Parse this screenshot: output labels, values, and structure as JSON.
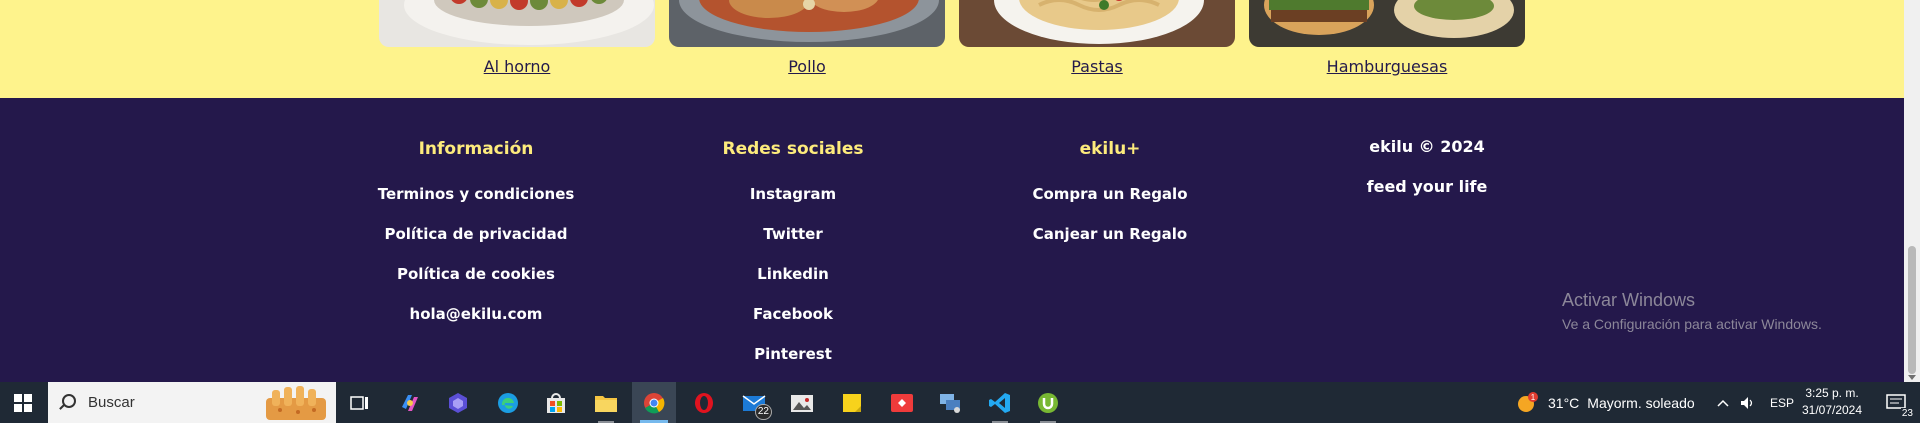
{
  "categories": [
    {
      "label": "Al horno",
      "icon": "baked-vegetables-photo"
    },
    {
      "label": "Pollo",
      "icon": "chicken-dish-photo"
    },
    {
      "label": "Pastas",
      "icon": "pasta-dish-photo"
    },
    {
      "label": "Hamburguesas",
      "icon": "burger-photo"
    }
  ],
  "footer": {
    "info": {
      "heading": "Información",
      "links": [
        "Terminos y condiciones",
        "Política de privacidad",
        "Política de cookies",
        "hola@ekilu.com"
      ]
    },
    "social": {
      "heading": "Redes sociales",
      "links": [
        "Instagram",
        "Twitter",
        "Linkedin",
        "Facebook",
        "Pinterest"
      ]
    },
    "plus": {
      "heading": "ekilu+",
      "links": [
        "Compra un Regalo",
        "Canjear un Regalo"
      ]
    },
    "brand": {
      "copyright": "ekilu © 2024",
      "tagline": "feed your life"
    }
  },
  "watermark": {
    "title": "Activar Windows",
    "subtitle": "Ve a Configuración para activar Windows."
  },
  "colors": {
    "band": "#fef38c",
    "footer_bg": "#24184b",
    "heading": "#fdeb7c",
    "link": "#ffffff"
  },
  "taskbar": {
    "search_placeholder": "Buscar",
    "apps": [
      "windows-start-icon",
      "task-view-icon",
      "copilot-icon",
      "app-icon",
      "edge-icon",
      "store-icon",
      "file-explorer-icon",
      "chrome-icon",
      "opera-icon",
      "mail-icon",
      "photos-icon",
      "sticky-notes-icon",
      "anydesk-icon",
      "network-app-icon",
      "vscode-icon",
      "utorrent-icon"
    ],
    "mail_badge": "22",
    "weather": {
      "temp": "31°C",
      "desc": "Mayorm. soleado"
    },
    "lang": "ESP",
    "time": "3:25 p. m.",
    "date": "31/07/2024",
    "notifications": "23"
  }
}
